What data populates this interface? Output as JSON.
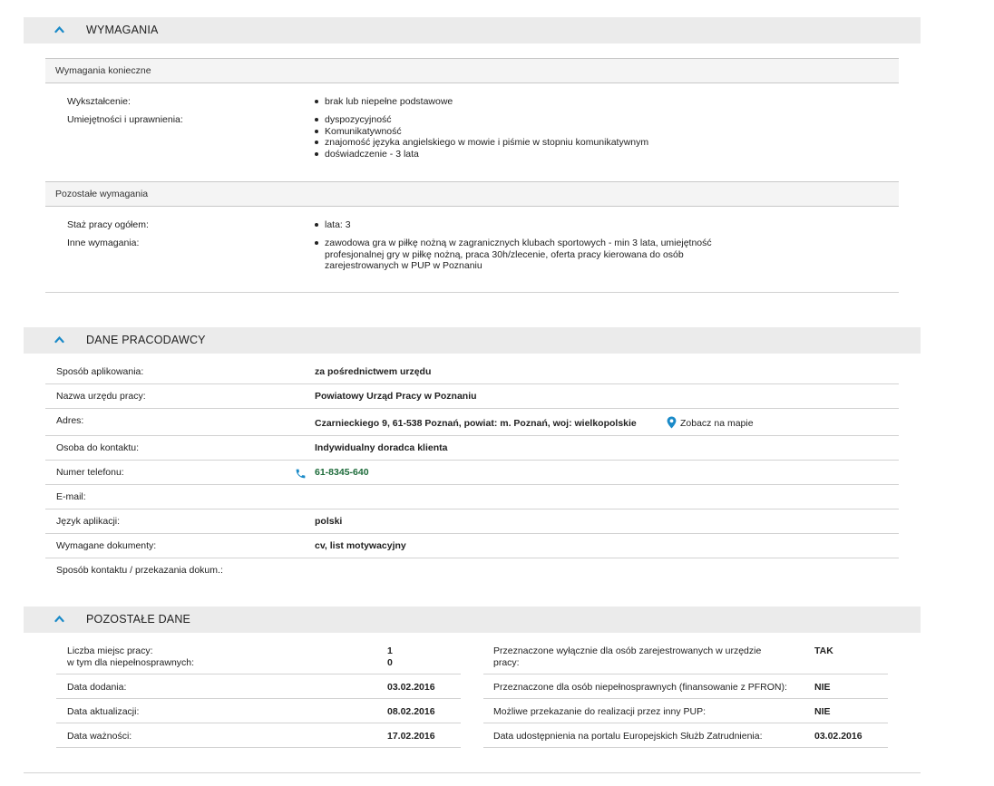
{
  "wymagania": {
    "title": "WYMAGANIA",
    "konieczne": {
      "title": "Wymagania konieczne",
      "rows": [
        {
          "label": "Wykształcenie:",
          "items": [
            "brak lub niepełne podstawowe"
          ]
        },
        {
          "label": "Umiejętności i uprawnienia:",
          "items": [
            "dyspozycyjność",
            "Komunikatywność",
            "znajomość języka angielskiego w mowie i piśmie w stopniu komunikatywnym",
            "doświadczenie - 3 lata"
          ]
        }
      ]
    },
    "pozostale": {
      "title": "Pozostałe wymagania",
      "rows": [
        {
          "label": "Staż pracy ogółem:",
          "items": [
            "lata: 3"
          ]
        },
        {
          "label": "Inne wymagania:",
          "items": [
            "zawodowa gra w piłkę nożną w zagranicznych klubach sportowych - min 3 lata, umiejętność profesjonalnej gry w piłkę nożną, praca 30h/zlecenie, oferta pracy kierowana do osób zarejestrowanych w PUP w Poznaniu"
          ]
        }
      ]
    }
  },
  "dane_pracodawcy": {
    "title": "DANE PRACODAWCY",
    "rows": [
      {
        "label": "Sposób aplikowania:",
        "value": "za pośrednictwem urzędu"
      },
      {
        "label": "Nazwa urzędu pracy:",
        "value": "Powiatowy Urząd Pracy w Poznaniu"
      },
      {
        "label": "Adres:",
        "value": "Czarnieckiego 9, 61-538 Poznań, powiat: m. Poznań, woj: wielkopolskie"
      },
      {
        "label": "Osoba do kontaktu:",
        "value": "Indywidualny doradca klienta"
      },
      {
        "label": "Numer telefonu:",
        "value": "61-8345-640"
      },
      {
        "label": "E-mail:",
        "value": ""
      },
      {
        "label": "Język aplikacji:",
        "value": "polski"
      },
      {
        "label": "Wymagane dokumenty:",
        "value": "cv, list motywacyjny"
      },
      {
        "label": "Sposób kontaktu / przekazania dokum.:",
        "value": ""
      }
    ],
    "map_link": "Zobacz na mapie",
    "map_icon": "map-pin-icon",
    "phone_icon": "phone-icon"
  },
  "pozostale_dane": {
    "title": "POZOSTAŁE DANE",
    "left": [
      {
        "label": "Liczba miejsc pracy:",
        "label2": "w tym dla niepełnosprawnych:",
        "value": "1",
        "value2": "0"
      },
      {
        "label": "Data dodania:",
        "value": "03.02.2016"
      },
      {
        "label": "Data aktualizacji:",
        "value": "08.02.2016"
      },
      {
        "label": "Data ważności:",
        "value": "17.02.2016"
      }
    ],
    "right": [
      {
        "label": "Przeznaczone wyłącznie dla osób zarejestrowanych w urzędzie pracy:",
        "value": "TAK"
      },
      {
        "label": "Przeznaczone dla osób niepełnosprawnych (finansowanie z PFRON):",
        "value": "NIE"
      },
      {
        "label": "Możliwe przekazanie do realizacji przez inny PUP:",
        "value": "NIE"
      },
      {
        "label": "Data udostępnienia na portalu Europejskich Służb Zatrudnienia:",
        "value": "03.02.2016"
      }
    ]
  },
  "colors": {
    "accent": "#1a8ac8",
    "header_bg": "#ebebeb",
    "phone_green": "#1d6b3a"
  }
}
